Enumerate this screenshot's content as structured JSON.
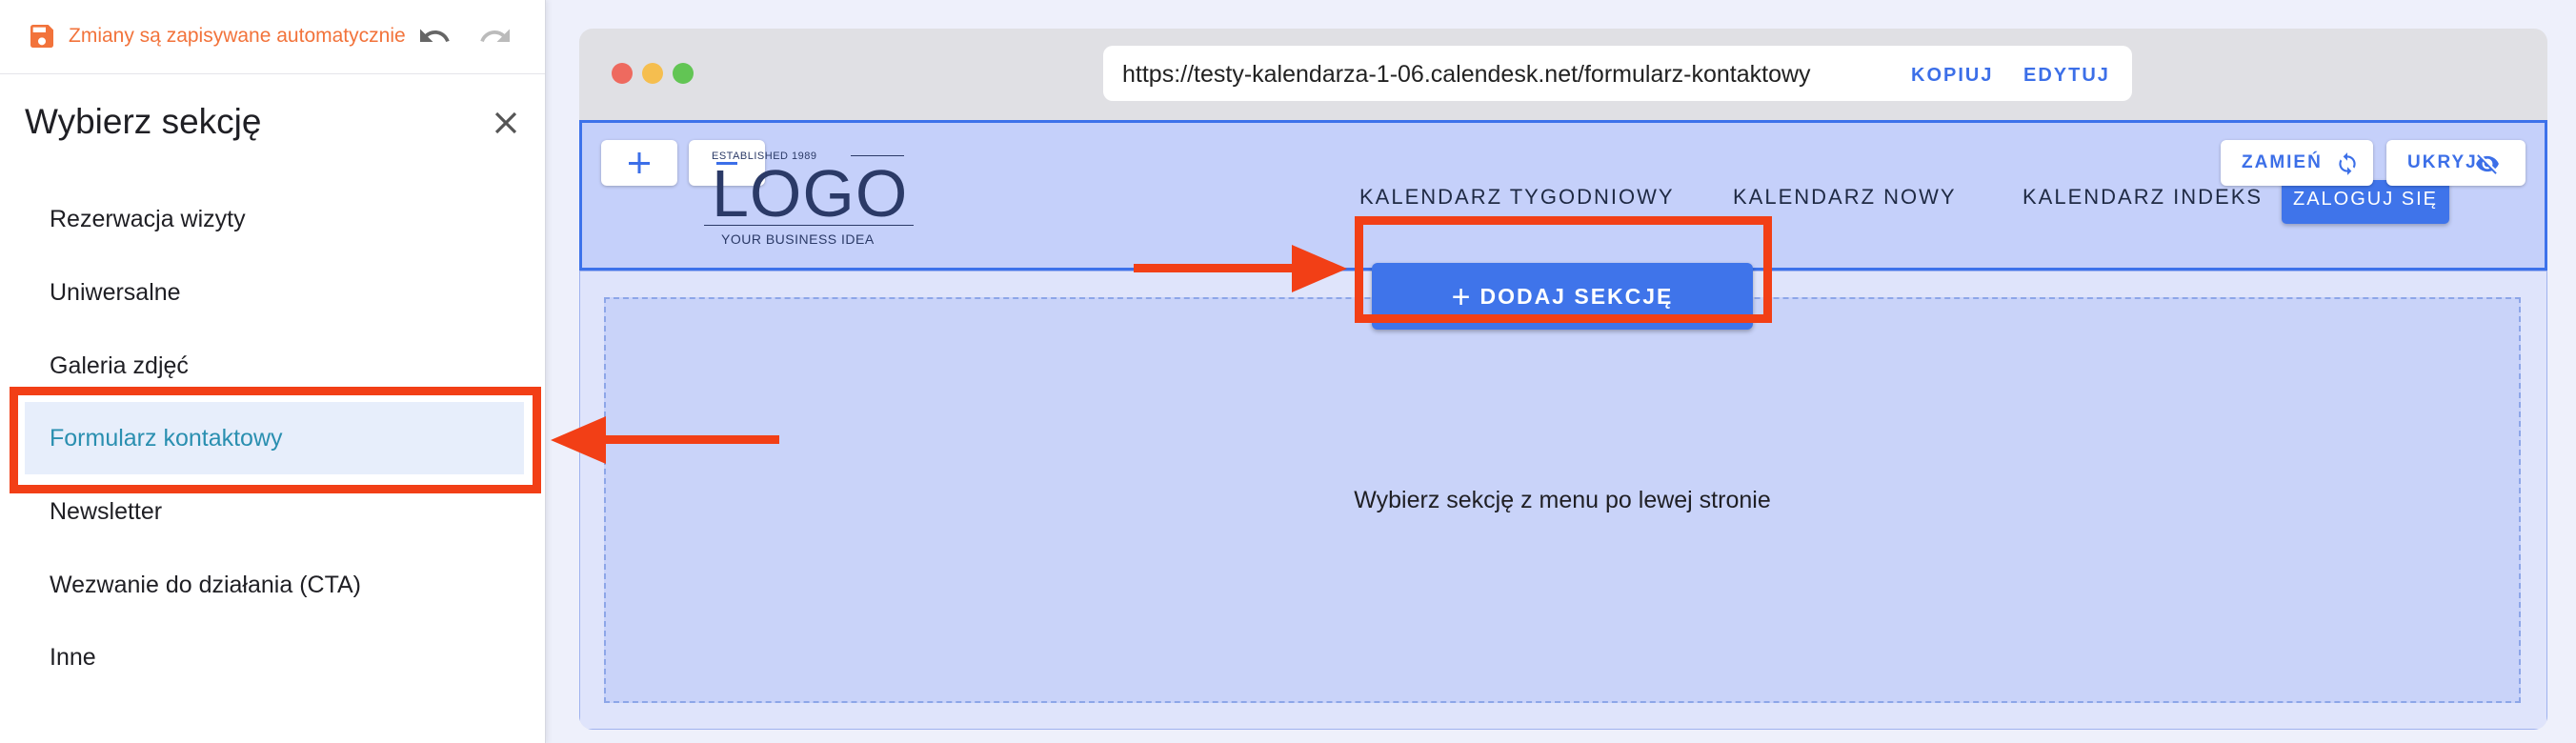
{
  "editor": {
    "autosave_text": "Zmiany są zapisywane automatycznie",
    "panel_title": "Wybierz sekcję",
    "sections": [
      {
        "label": "Rezerwacja wizyty",
        "active": false
      },
      {
        "label": "Uniwersalne",
        "active": false
      },
      {
        "label": "Galeria zdjęć",
        "active": false
      },
      {
        "label": "Formularz kontaktowy",
        "active": true
      },
      {
        "label": "Newsletter",
        "active": false
      },
      {
        "label": "Wezwanie do działania (CTA)",
        "active": false
      },
      {
        "label": "Inne",
        "active": false
      }
    ],
    "icons": {
      "save": "save-icon",
      "undo": "undo-icon",
      "redo": "redo-icon",
      "close": "close-icon"
    }
  },
  "browser": {
    "url": "https://testy-kalendarza-1-06.calendesk.net/formularz-kontaktowy",
    "copy_label": "KOPIUJ",
    "edit_label": "EDYTUJ"
  },
  "site": {
    "logo": {
      "established": "ESTABLISHED 1989",
      "text": "LOGO",
      "tagline": "YOUR BUSINESS IDEA"
    },
    "nav": [
      "KALENDARZ TYGODNIOWY",
      "KALENDARZ NOWY",
      "KALENDARZ INDEKS"
    ],
    "login_label": "ZALOGUJ SIĘ",
    "replace_label": "ZAMIEŃ",
    "hide_label": "UKRYJ",
    "add_section_label": "DODAJ SEKCJĘ",
    "placeholder_text": "Wybierz sekcję z menu po lewej stronie"
  },
  "colors": {
    "accent": "#3f74ea",
    "autosave": "#f2733b",
    "annotation": "#f23f16",
    "active_item": "#2a8fb0"
  }
}
